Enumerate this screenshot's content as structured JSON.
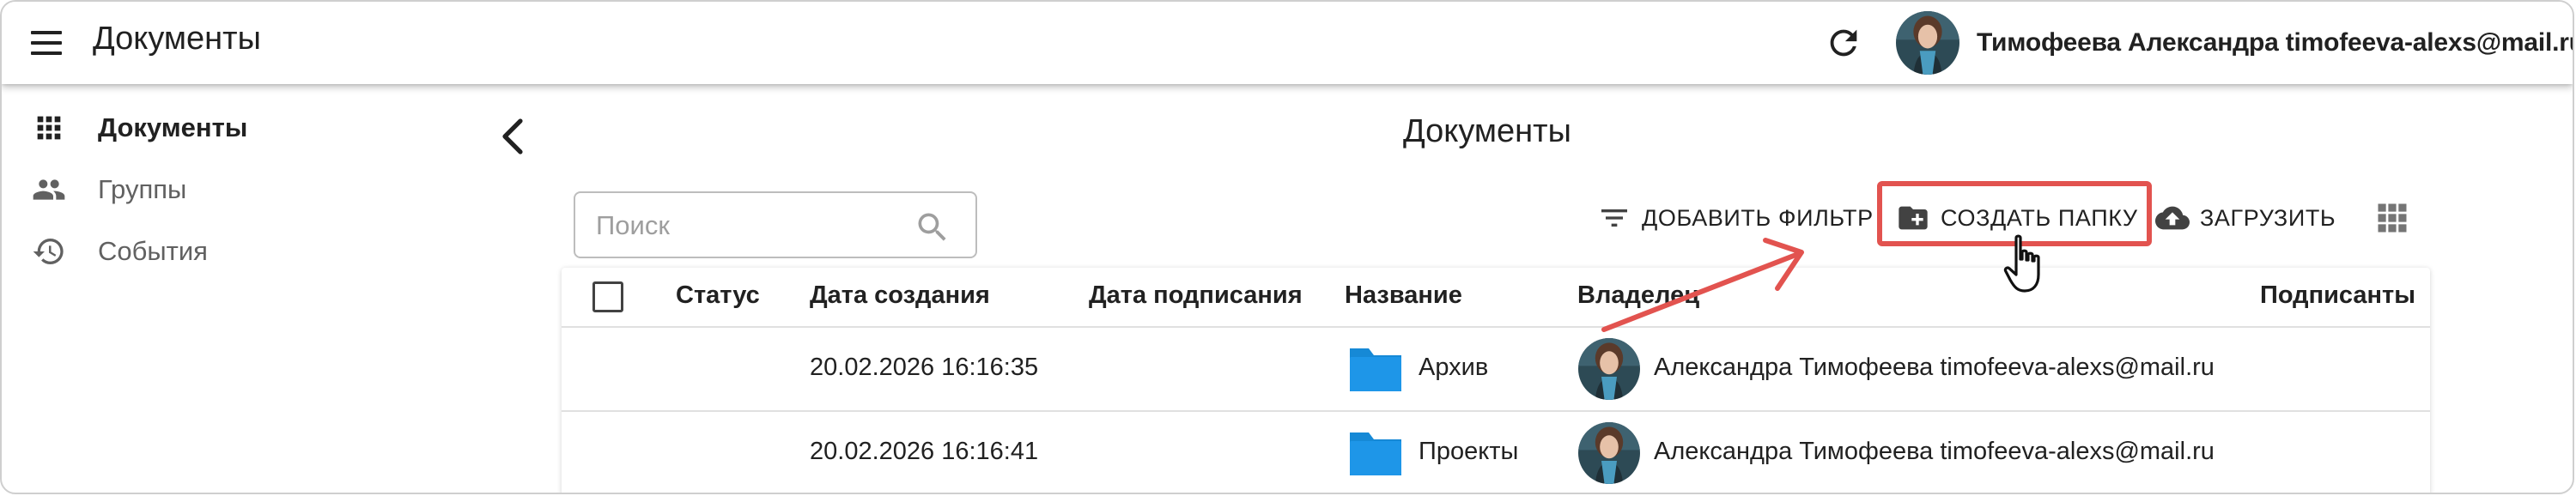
{
  "app": {
    "title": "Документы"
  },
  "user": {
    "display": "Тимофеева Александра timofeeva-alexs@mail.ru"
  },
  "sidebar": {
    "items": [
      {
        "label": "Документы",
        "icon": "apps-grid-icon",
        "active": true
      },
      {
        "label": "Группы",
        "icon": "people-icon",
        "active": false
      },
      {
        "label": "События",
        "icon": "history-icon",
        "active": false
      }
    ]
  },
  "main": {
    "title": "Документы",
    "search": {
      "placeholder": "Поиск",
      "value": ""
    },
    "toolbar": {
      "filter_label": "ДОБАВИТЬ ФИЛЬТР",
      "create_folder_label": "СОЗДАТЬ ПАПКУ",
      "upload_label": "ЗАГРУЗИТЬ"
    },
    "table": {
      "columns": [
        "Статус",
        "Дата создания",
        "Дата подписания",
        "Название",
        "Владелец",
        "Подписанты"
      ],
      "rows": [
        {
          "status": "",
          "created": "20.02.2026 16:16:35",
          "signed": "",
          "name": "Архив",
          "owner": "Александра Тимофеева timofeeva-alexs@mail.ru",
          "signers": ""
        },
        {
          "status": "",
          "created": "20.02.2026 16:16:41",
          "signed": "",
          "name": "Проекты",
          "owner": "Александра Тимофеева timofeeva-alexs@mail.ru",
          "signers": ""
        }
      ]
    }
  },
  "colors": {
    "highlight": "#e2534f",
    "folder": "#1e96e8",
    "text": "#212121",
    "muted": "#616161"
  }
}
